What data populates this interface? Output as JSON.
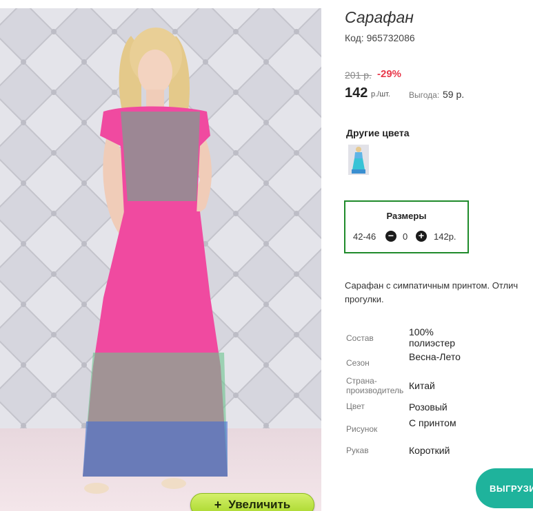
{
  "product": {
    "title": "Сарафан",
    "code": "Код: 965732086",
    "old_price": "201 р.",
    "discount": "-29%",
    "price": "142",
    "price_unit": "р./шт.",
    "benefit_label": "Выгода:",
    "benefit_value": "59 р."
  },
  "other_colors": {
    "heading": "Другие цвета"
  },
  "sizes": {
    "heading": "Размеры",
    "range": "42-46",
    "minus": "−",
    "quantity": "0",
    "plus": "+",
    "price": "142р."
  },
  "description": "Сарафан с симпатичным принтом. Отлич прогулки.",
  "attributes": [
    {
      "label": "Состав",
      "value": "100% полиэстер"
    },
    {
      "label": "Сезон",
      "value": "Весна-Лето"
    },
    {
      "label": "Страна-производитель",
      "value": "Китай"
    },
    {
      "label": "Цвет",
      "value": "Розовый"
    },
    {
      "label": "Рисунок",
      "value": "С принтом"
    },
    {
      "label": "Рукав",
      "value": "Короткий"
    }
  ],
  "zoom_button": {
    "icon": "+",
    "label": "Увеличить"
  },
  "export_button": {
    "label": "ВЫГРУЗИ"
  },
  "colors": {
    "discount": "#e8384a",
    "sizes_border": "#1e8a2a",
    "zoom_button": "#b5e03a",
    "export_button": "#1fb39c",
    "dress": "#f04aa0"
  }
}
